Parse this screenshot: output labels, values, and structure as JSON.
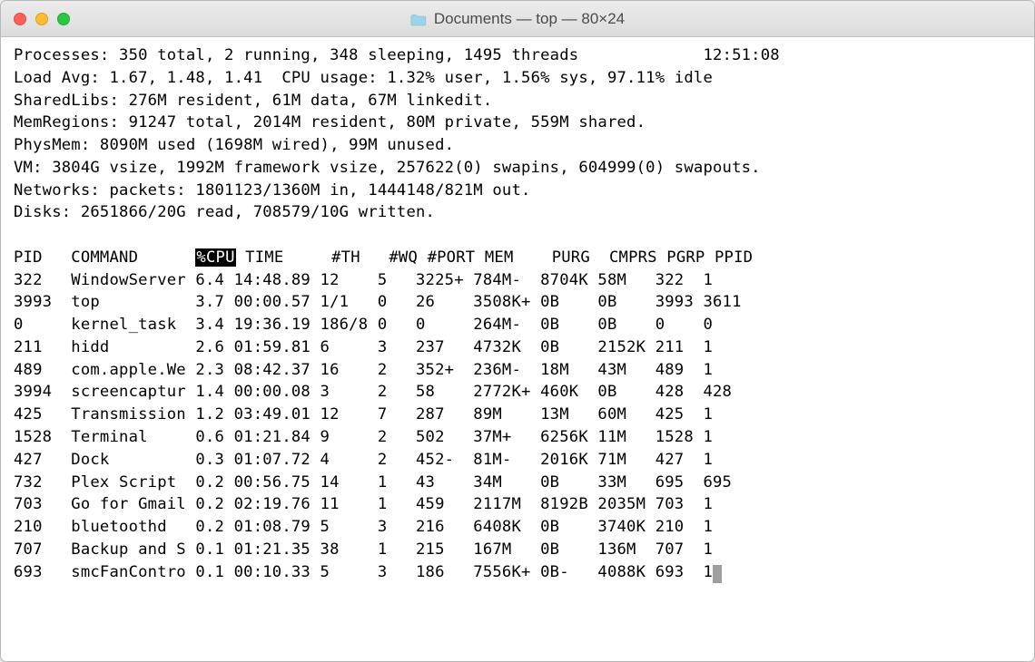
{
  "titlebar": {
    "title": "Documents — top — 80×24"
  },
  "stats": {
    "processes": "Processes: 350 total, 2 running, 348 sleeping, 1495 threads",
    "clock": "12:51:08",
    "loadavg": "Load Avg: 1.67, 1.48, 1.41  CPU usage: 1.32% user, 1.56% sys, 97.11% idle",
    "sharedlibs": "SharedLibs: 276M resident, 61M data, 67M linkedit.",
    "memregions": "MemRegions: 91247 total, 2014M resident, 80M private, 559M shared.",
    "physmem": "PhysMem: 8090M used (1698M wired), 99M unused.",
    "vm": "VM: 3804G vsize, 1992M framework vsize, 257622(0) swapins, 604999(0) swapouts.",
    "networks": "Networks: packets: 1801123/1360M in, 1444148/821M out.",
    "disks": "Disks: 2651866/20G read, 708579/10G written."
  },
  "columns": {
    "pid": "PID",
    "command": "COMMAND",
    "cpu": "%CPU",
    "time": "TIME",
    "th": "#TH",
    "wq": "#WQ",
    "port": "#PORT",
    "mem": "MEM",
    "purg": "PURG",
    "cmprs": "CMPRS",
    "pgrp": "PGRP",
    "ppid": "PPID"
  },
  "rows": [
    {
      "pid": "322",
      "command": "WindowServer",
      "cpu": "6.4",
      "time": "14:48.89",
      "th": "12",
      "wq": "5",
      "port": "3225+",
      "mem": "784M-",
      "purg": "8704K",
      "cmprs": "58M",
      "pgrp": "322",
      "ppid": "1"
    },
    {
      "pid": "3993",
      "command": "top",
      "cpu": "3.7",
      "time": "00:00.57",
      "th": "1/1",
      "wq": "0",
      "port": "26",
      "mem": "3508K+",
      "purg": "0B",
      "cmprs": "0B",
      "pgrp": "3993",
      "ppid": "3611"
    },
    {
      "pid": "0",
      "command": "kernel_task",
      "cpu": "3.4",
      "time": "19:36.19",
      "th": "186/8",
      "wq": "0",
      "port": "0",
      "mem": "264M-",
      "purg": "0B",
      "cmprs": "0B",
      "pgrp": "0",
      "ppid": "0"
    },
    {
      "pid": "211",
      "command": "hidd",
      "cpu": "2.6",
      "time": "01:59.81",
      "th": "6",
      "wq": "3",
      "port": "237",
      "mem": "4732K",
      "purg": "0B",
      "cmprs": "2152K",
      "pgrp": "211",
      "ppid": "1"
    },
    {
      "pid": "489",
      "command": "com.apple.We",
      "cpu": "2.3",
      "time": "08:42.37",
      "th": "16",
      "wq": "2",
      "port": "352+",
      "mem": "236M-",
      "purg": "18M",
      "cmprs": "43M",
      "pgrp": "489",
      "ppid": "1"
    },
    {
      "pid": "3994",
      "command": "screencaptur",
      "cpu": "1.4",
      "time": "00:00.08",
      "th": "3",
      "wq": "2",
      "port": "58",
      "mem": "2772K+",
      "purg": "460K",
      "cmprs": "0B",
      "pgrp": "428",
      "ppid": "428"
    },
    {
      "pid": "425",
      "command": "Transmission",
      "cpu": "1.2",
      "time": "03:49.01",
      "th": "12",
      "wq": "7",
      "port": "287",
      "mem": "89M",
      "purg": "13M",
      "cmprs": "60M",
      "pgrp": "425",
      "ppid": "1"
    },
    {
      "pid": "1528",
      "command": "Terminal",
      "cpu": "0.6",
      "time": "01:21.84",
      "th": "9",
      "wq": "2",
      "port": "502",
      "mem": "37M+",
      "purg": "6256K",
      "cmprs": "11M",
      "pgrp": "1528",
      "ppid": "1"
    },
    {
      "pid": "427",
      "command": "Dock",
      "cpu": "0.3",
      "time": "01:07.72",
      "th": "4",
      "wq": "2",
      "port": "452-",
      "mem": "81M-",
      "purg": "2016K",
      "cmprs": "71M",
      "pgrp": "427",
      "ppid": "1"
    },
    {
      "pid": "732",
      "command": "Plex Script",
      "cpu": "0.2",
      "time": "00:56.75",
      "th": "14",
      "wq": "1",
      "port": "43",
      "mem": "34M",
      "purg": "0B",
      "cmprs": "33M",
      "pgrp": "695",
      "ppid": "695"
    },
    {
      "pid": "703",
      "command": "Go for Gmail",
      "cpu": "0.2",
      "time": "02:19.76",
      "th": "11",
      "wq": "1",
      "port": "459",
      "mem": "2117M",
      "purg": "8192B",
      "cmprs": "2035M",
      "pgrp": "703",
      "ppid": "1"
    },
    {
      "pid": "210",
      "command": "bluetoothd",
      "cpu": "0.2",
      "time": "01:08.79",
      "th": "5",
      "wq": "3",
      "port": "216",
      "mem": "6408K",
      "purg": "0B",
      "cmprs": "3740K",
      "pgrp": "210",
      "ppid": "1"
    },
    {
      "pid": "707",
      "command": "Backup and S",
      "cpu": "0.1",
      "time": "01:21.35",
      "th": "38",
      "wq": "1",
      "port": "215",
      "mem": "167M",
      "purg": "0B",
      "cmprs": "136M",
      "pgrp": "707",
      "ppid": "1"
    },
    {
      "pid": "693",
      "command": "smcFanContro",
      "cpu": "0.1",
      "time": "00:10.33",
      "th": "5",
      "wq": "3",
      "port": "186",
      "mem": "7556K+",
      "purg": "0B-",
      "cmprs": "4088K",
      "pgrp": "693",
      "ppid": "1"
    }
  ]
}
